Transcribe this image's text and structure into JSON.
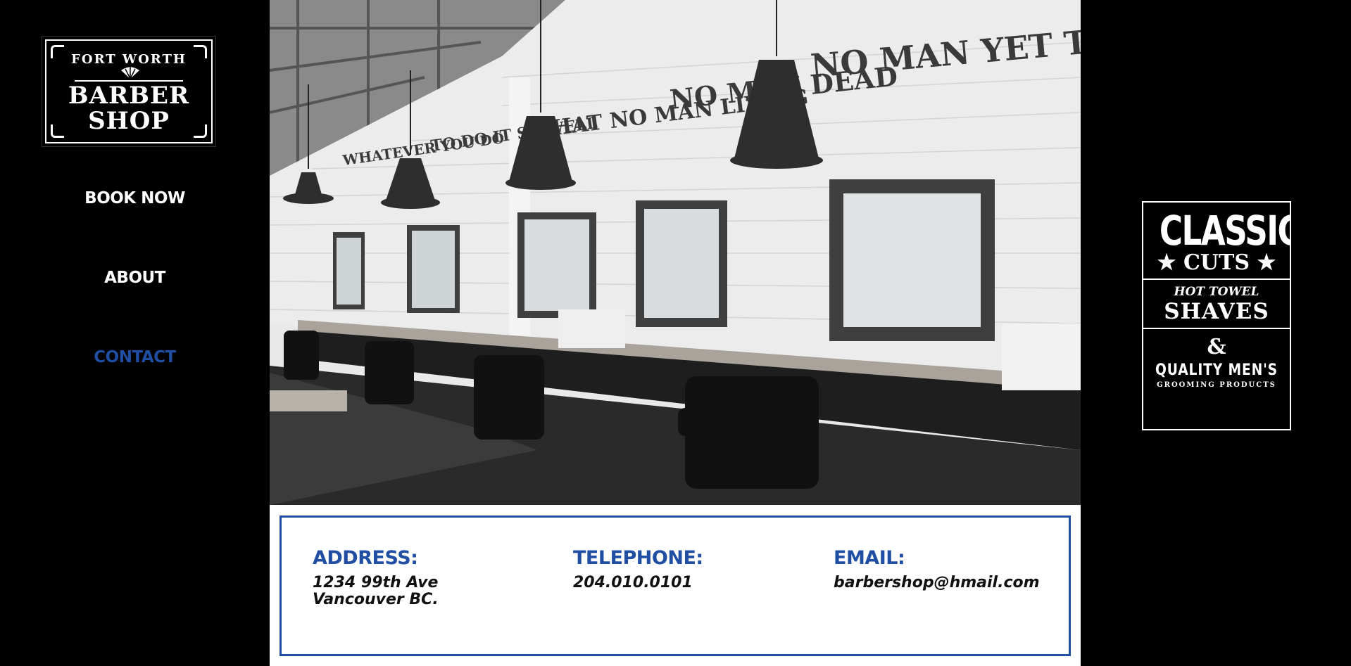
{
  "logo": {
    "top_line": "FORT WORTH",
    "line1": "BARBER",
    "line2": "SHOP"
  },
  "nav": {
    "items": [
      {
        "label": "BOOK NOW",
        "active": false
      },
      {
        "label": "ABOUT",
        "active": false
      },
      {
        "label": "CONTACT",
        "active": true
      }
    ]
  },
  "hero": {
    "wall_text": {
      "part1": "WHATEVER YOU DO",
      "part2": "TO DO IT SO WELL",
      "part3": "THAT NO MAN LIVING",
      "part4": "NO MAN DEAD",
      "part5": "NO MAN YET TO BE BORN"
    }
  },
  "contact": {
    "address_label": "ADDRESS:",
    "address_line1": "1234 99th Ave",
    "address_line2": "Vancouver BC.",
    "telephone_label": "TELEPHONE:",
    "telephone_value": "204.010.0101",
    "email_label": "EMAIL:",
    "email_value": "barbershop@hmail.com"
  },
  "badge": {
    "line1": "CLASSIC",
    "line2": "★ CUTS ★",
    "line3": "HOT TOWEL",
    "line4": "SHAVES",
    "line5": "&",
    "line6": "QUALITY MEN'S",
    "line7": "GROOMING PRODUCTS"
  },
  "colors": {
    "accent": "#1f4ea3",
    "background": "#000000"
  }
}
